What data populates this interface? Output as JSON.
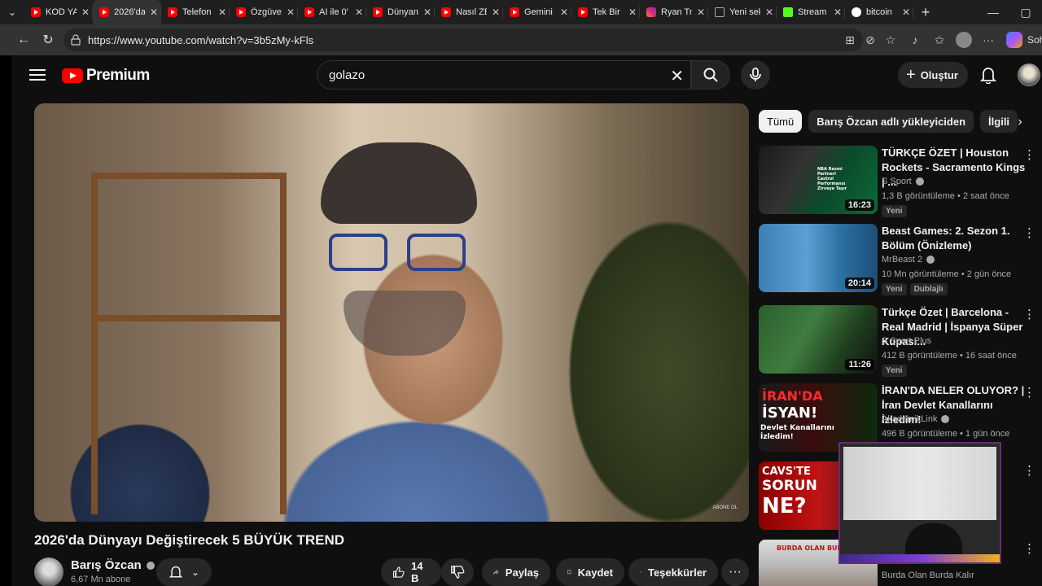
{
  "browser": {
    "tabs": [
      {
        "title": "KOD YA",
        "icon": "youtube-icon",
        "active": false
      },
      {
        "title": "2026'da",
        "icon": "youtube-icon",
        "active": true
      },
      {
        "title": "Telefon",
        "icon": "youtube-icon",
        "active": false
      },
      {
        "title": "Özgüve",
        "icon": "youtube-icon",
        "active": false
      },
      {
        "title": "AI ile 0'",
        "icon": "youtube-icon",
        "active": false
      },
      {
        "title": "Dünyan",
        "icon": "youtube-icon",
        "active": false
      },
      {
        "title": "Nasıl ZE",
        "icon": "youtube-icon",
        "active": false
      },
      {
        "title": "Gemini",
        "icon": "youtube-icon",
        "active": false
      },
      {
        "title": "Tek Bir",
        "icon": "youtube-icon",
        "active": false
      },
      {
        "title": "Ryan Tr",
        "icon": "instagram-icon",
        "active": false
      },
      {
        "title": "Yeni sek",
        "icon": "document-icon",
        "active": false
      },
      {
        "title": "Stream",
        "icon": "kick-icon",
        "active": false
      },
      {
        "title": "bitcoin",
        "icon": "google-icon",
        "active": false
      }
    ],
    "url": "https://www.youtube.com/watch?v=3b5zMy-kFls",
    "sidebar_label": "Soh"
  },
  "header": {
    "logo_text": "Premium",
    "search_value": "golazo",
    "create_label": "Oluştur"
  },
  "video": {
    "title": "2026'da Dünyayı Değiştirecek 5 BÜYÜK TREND",
    "watermark": "ABONE OL",
    "channel_name": "Barış Özcan",
    "subscribers": "6,67 Mn abone",
    "likes": "14 B",
    "share_label": "Paylaş",
    "save_label": "Kaydet",
    "thanks_label": "Teşekkürler"
  },
  "chips": [
    "Tümü",
    "Barış Özcan adlı yükleyiciden",
    "İlgili"
  ],
  "recommendations": [
    {
      "title": "TÜRKÇE ÖZET | Houston Rockets - Sacramento Kings | ...",
      "channel": "S Sport",
      "meta": "1,3 B görüntüleme • 2 saat önce",
      "duration": "16:23",
      "badges": [
        "Yeni"
      ]
    },
    {
      "title": "Beast Games: 2. Sezon 1. Bölüm (Önizleme)",
      "channel": "MrBeast 2",
      "meta": "10 Mn görüntüleme • 2 gün önce",
      "duration": "20:14",
      "badges": [
        "Yeni",
        "Dublajlı"
      ]
    },
    {
      "title": "Türkçe Özet | Barcelona - Real Madrid | İspanya Süper Kupası...",
      "channel": "S Sport Plus",
      "meta": "412 B görüntüleme • 16 saat önce",
      "duration": "11:26",
      "badges": [
        "Yeni"
      ]
    },
    {
      "title": "İRAN'DA NELER OLUYOR? | İran Devlet Kanallarını İzledim!",
      "channel": "AkademikLink",
      "meta": "496 B görüntüleme • 1 gün önce",
      "duration": "",
      "badges": []
    },
    {
      "title": "",
      "channel": "",
      "meta": "",
      "duration": "",
      "badges": []
    },
    {
      "title": "",
      "channel": "Burda Olan Burda Kalır",
      "meta": "",
      "duration": "",
      "badges": []
    }
  ],
  "thumbnail_text": {
    "t1": "NBA Resmi Partneri Castrol Performansı Zirveye Taşır",
    "t4a": "İRAN'DA",
    "t4b": "İSYAN!",
    "t4c": "Devlet Kanallarını İzledim!",
    "t5a": "CAVS'TE",
    "t5b": "SORUN",
    "t5c": "NE?",
    "t6": "BURDA OLAN BURDA"
  },
  "colors": {
    "brand_red": "#ff0000",
    "background": "#0f0f0f",
    "chip": "#272727"
  }
}
